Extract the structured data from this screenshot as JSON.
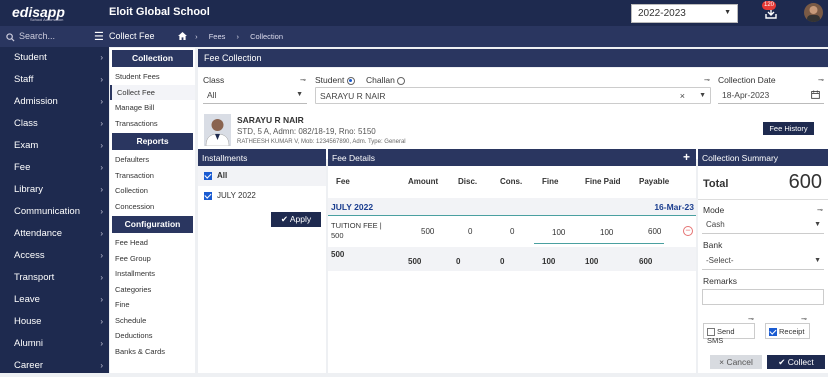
{
  "header": {
    "logo": "edisapp",
    "logo_sub": "School Automation",
    "school_name": "Eloit Global School",
    "year": "2022-2023",
    "notification_count": "120"
  },
  "subbar": {
    "search_placeholder": "Search...",
    "page": "Collect Fee",
    "breadcrumb": [
      "Fees",
      "Collection"
    ]
  },
  "sidebar": {
    "items": [
      "Student",
      "Staff",
      "Admission",
      "Class",
      "Exam",
      "Fee",
      "Library",
      "Communication",
      "Attendance",
      "Access",
      "Transport",
      "Leave",
      "House",
      "Alumni",
      "Career"
    ]
  },
  "subnav": {
    "collection_head": "Collection",
    "collection_links": [
      "Student Fees",
      "Collect Fee",
      "Manage Bill",
      "Transactions"
    ],
    "reports_head": "Reports",
    "reports_links": [
      "Defaulters",
      "Transaction",
      "Collection",
      "Concession"
    ],
    "config_head": "Configuration",
    "config_links": [
      "Fee Head",
      "Fee Group",
      "Installments",
      "Categories",
      "Fine",
      "Schedule",
      "Deductions",
      "Banks & Cards"
    ]
  },
  "fee_collection": {
    "title": "Fee Collection",
    "class_label": "Class",
    "class_value": "All",
    "student_label": "Student",
    "challan_label": "Challan",
    "student_value": "SARAYU R NAIR",
    "date_label": "Collection Date",
    "date_value": "18-Apr-2023"
  },
  "student": {
    "name": "SARAYU R NAIR",
    "std": "STD, 5 A, Admn: 082/18-19, Rno: 5150",
    "info": "RATHEESH KUMAR V, Mob: 1234567890, Adm. Type: General",
    "fee_history": "Fee History"
  },
  "installments": {
    "title": "Installments",
    "all_label": "All",
    "items": [
      "JULY 2022"
    ],
    "apply": "Apply"
  },
  "fee_details": {
    "title": "Fee Details",
    "columns": [
      "Fee",
      "Amount",
      "Disc.",
      "Cons.",
      "Fine",
      "Fine Paid",
      "Payable"
    ],
    "group": "JULY 2022",
    "group_date": "16-Mar-23",
    "row": {
      "fee": "TUITION FEE | 500",
      "amount": "500",
      "disc": "0",
      "cons": "0",
      "fine": "100",
      "fine_paid": "100",
      "payable": "600"
    },
    "total": {
      "fee": "500",
      "amount": "500",
      "disc": "0",
      "cons": "0",
      "fine": "100",
      "fine_paid": "100",
      "payable": "600"
    }
  },
  "summary": {
    "title": "Collection Summary",
    "total_label": "Total",
    "total_value": "600",
    "mode_label": "Mode",
    "mode_value": "Cash",
    "bank_label": "Bank",
    "bank_value": "-Select-",
    "remarks_label": "Remarks",
    "send_sms": "Send SMS",
    "receipt": "Receipt",
    "cancel": "Cancel",
    "collect": "Collect"
  },
  "colors": {
    "navy": "#1e2a4f",
    "navy2": "#2a3660",
    "accent": "#1a5bd1"
  }
}
